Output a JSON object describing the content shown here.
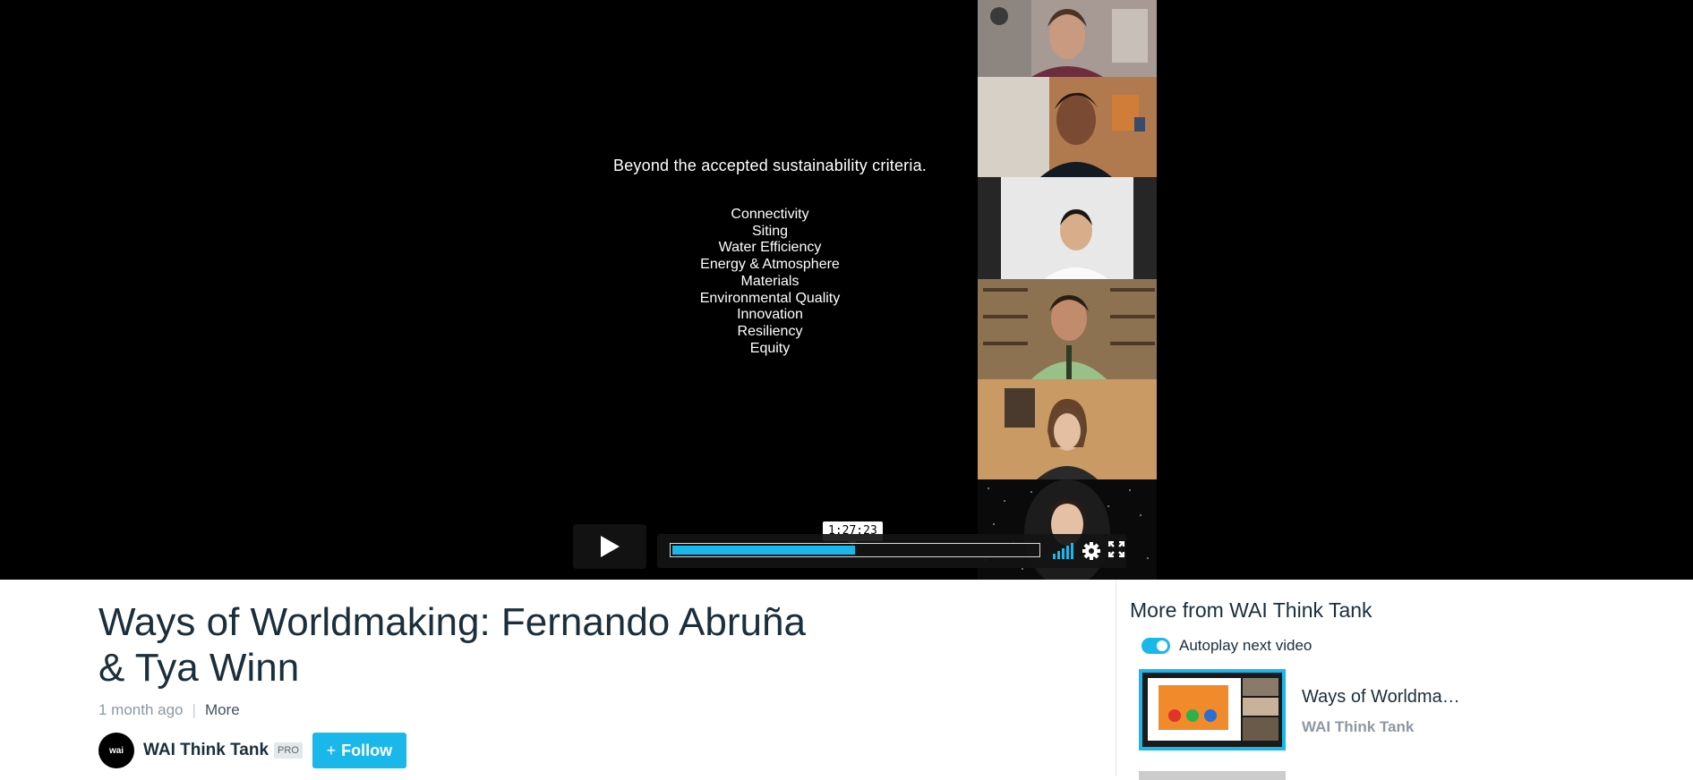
{
  "player": {
    "slide": {
      "heading": "Beyond the accepted sustainability criteria.",
      "criteria": [
        "Connectivity",
        "Siting",
        "Water Efficiency",
        "Energy & Atmosphere",
        "Materials",
        "Environmental Quality",
        "Innovation",
        "Resiliency",
        "Equity"
      ]
    },
    "controls": {
      "hover_time": "1:27:23",
      "progress_fraction": 0.5,
      "accent_color": "#1ab7ea"
    }
  },
  "video": {
    "title_line1": "Ways of Worldmaking: Fernando Abruña",
    "title_line2": "& Tya Winn",
    "posted": "1 month ago",
    "more_label": "More",
    "owner": {
      "name": "WAI Think Tank",
      "avatar_text": "wai",
      "badge": "PRO",
      "follow_label": "Follow"
    }
  },
  "sidebar": {
    "title": "More from WAI Think Tank",
    "autoplay_label": "Autoplay next video",
    "related": [
      {
        "title": "Ways of Worldma…",
        "owner": "WAI Think Tank"
      }
    ]
  }
}
